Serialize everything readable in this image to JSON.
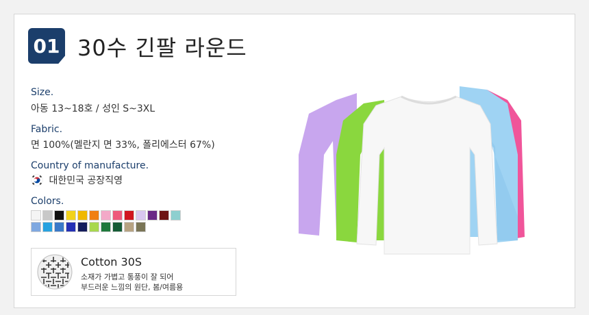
{
  "header": {
    "number": "01",
    "title": "30수 긴팔 라운드"
  },
  "size": {
    "label": "Size.",
    "value": "아동 13~18호 / 성인 S~3XL"
  },
  "fabric": {
    "label": "Fabric.",
    "value": "면 100%(멜란지 면 33%, 폴리에스터 67%)"
  },
  "country": {
    "label": "Country of manufacture.",
    "value": "대한민국 공장직영",
    "flag_icon": "korea-flag-icon"
  },
  "colors": {
    "label": "Colors.",
    "row1": [
      "#f4f4f4",
      "#c8c8c8",
      "#111111",
      "#f1d21c",
      "#f0b800",
      "#f07f12",
      "#f3a9c8",
      "#ee5a7b",
      "#d0161f",
      "#d9c8f0",
      "#6a2a86",
      "#6e1414",
      "#8ecfcf"
    ],
    "row2": [
      "#7fa8e0",
      "#27a2e0",
      "#3a79c8",
      "#2530b5",
      "#141c5c",
      "#a8d84e",
      "#1f7a3c",
      "#155c36",
      "#b6a282",
      "#7a7556"
    ]
  },
  "material": {
    "title": "Cotton 30S",
    "description_line1": "소재가 가볍고 통풍이 잘 되어",
    "description_line2": "부드러운 느낌의 원단, 봄/여름용",
    "icon": "fabric-weave-icon"
  },
  "product_image": {
    "icon": "tshirt-stack-image"
  }
}
